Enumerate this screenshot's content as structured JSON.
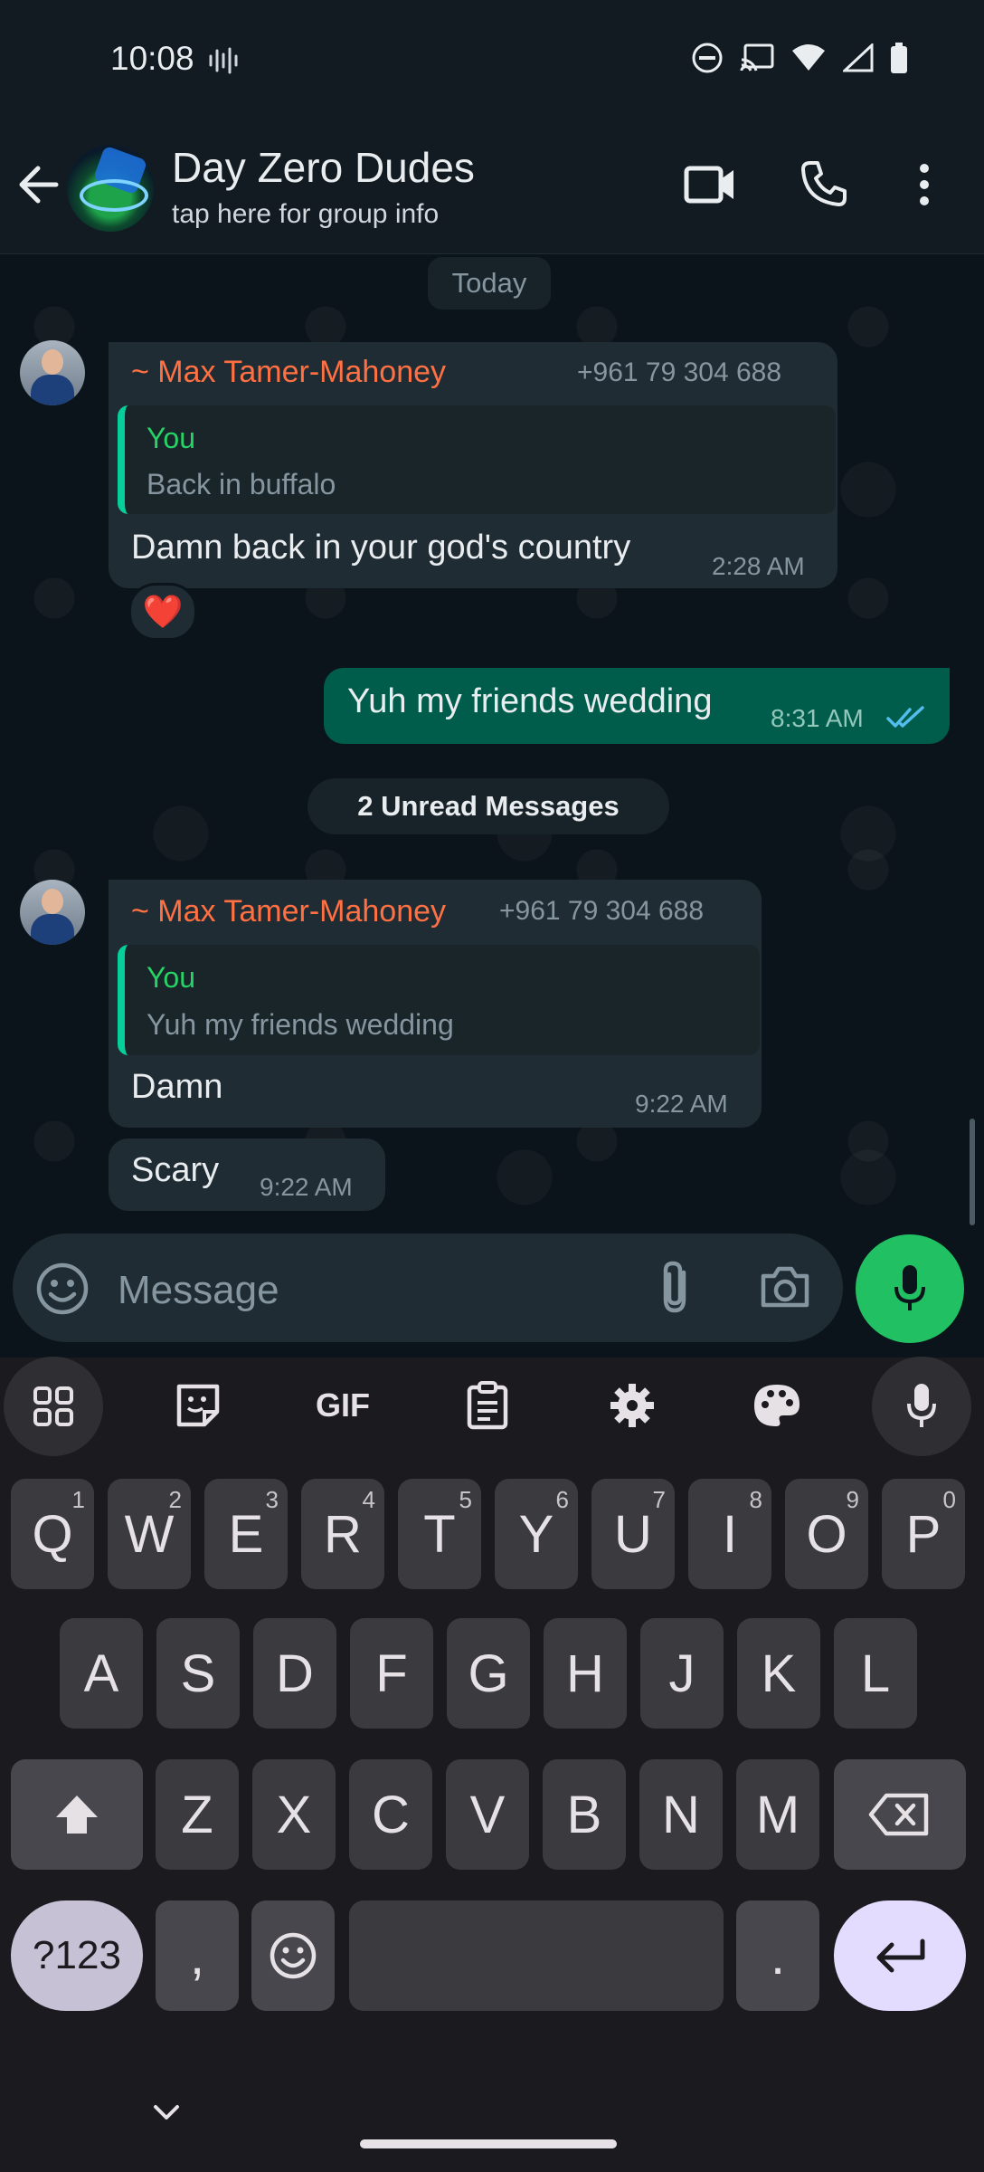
{
  "status_bar": {
    "time": "10:08"
  },
  "header": {
    "title": "Day Zero Dudes",
    "subtitle": "tap here for group info"
  },
  "chat": {
    "date_chip": "Today",
    "unread_chip": "2 Unread Messages",
    "messages": [
      {
        "sender": "~ Max Tamer-Mahoney",
        "phone": "+961 79 304 688",
        "quote_name": "You",
        "quote_text": "Back in buffalo",
        "text": "Damn back in your god's country",
        "time": "2:28 AM",
        "reaction": "❤️"
      },
      {
        "text": "Yuh my friends wedding",
        "time": "8:31 AM",
        "ticks": "read"
      },
      {
        "sender": "~ Max Tamer-Mahoney",
        "phone": "+961 79 304 688",
        "quote_name": "You",
        "quote_text": "Yuh my friends wedding",
        "text": "Damn",
        "time": "9:22 AM"
      },
      {
        "text": "Scary",
        "time": "9:22 AM"
      }
    ]
  },
  "composer": {
    "placeholder": "Message"
  },
  "keyboard": {
    "toolbar": {
      "gif_label": "GIF"
    },
    "row1": [
      {
        "k": "Q",
        "h": "1"
      },
      {
        "k": "W",
        "h": "2"
      },
      {
        "k": "E",
        "h": "3"
      },
      {
        "k": "R",
        "h": "4"
      },
      {
        "k": "T",
        "h": "5"
      },
      {
        "k": "Y",
        "h": "6"
      },
      {
        "k": "U",
        "h": "7"
      },
      {
        "k": "I",
        "h": "8"
      },
      {
        "k": "O",
        "h": "9"
      },
      {
        "k": "P",
        "h": "0"
      }
    ],
    "row2": [
      "A",
      "S",
      "D",
      "F",
      "G",
      "H",
      "J",
      "K",
      "L"
    ],
    "row3": [
      "Z",
      "X",
      "C",
      "V",
      "B",
      "N",
      "M"
    ],
    "symbols_label": "?123",
    "comma": ",",
    "period": "."
  },
  "colors": {
    "accent_green": "#21c063",
    "sender_orange": "#ff7043",
    "outgoing_bubble": "#005c4b",
    "incoming_bubble": "#202c33",
    "read_ticks": "#53bdeb"
  }
}
